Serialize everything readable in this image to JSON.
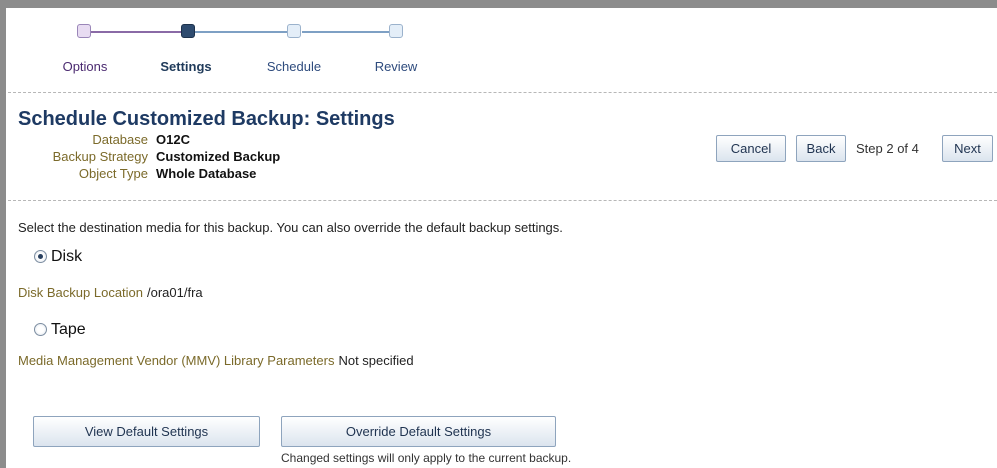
{
  "train": {
    "steps": [
      {
        "label": "Options",
        "state": "visited"
      },
      {
        "label": "Settings",
        "state": "current"
      },
      {
        "label": "Schedule",
        "state": "future"
      },
      {
        "label": "Review",
        "state": "future"
      }
    ]
  },
  "page": {
    "title": "Schedule Customized Backup: Settings",
    "info": [
      {
        "label": "Database",
        "value": "O12C"
      },
      {
        "label": "Backup Strategy",
        "value": "Customized Backup"
      },
      {
        "label": "Object Type",
        "value": "Whole Database"
      }
    ]
  },
  "nav": {
    "cancel": "Cancel",
    "back": "Back",
    "step_text": "Step 2 of 4",
    "next": "Next"
  },
  "content": {
    "instruction": "Select the destination media for this backup. You can also override the default backup settings.",
    "disk": {
      "label": "Disk",
      "selected": true,
      "location_label": "Disk Backup Location",
      "location_value": "/ora01/fra"
    },
    "tape": {
      "label": "Tape",
      "selected": false,
      "mmv_label": "Media Management Vendor (MMV) Library Parameters",
      "mmv_value": "Not specified"
    },
    "view_default": "View Default Settings",
    "override_default": "Override Default Settings",
    "override_note": "Changed settings will only apply to the current backup."
  },
  "colors": {
    "title": "#1e3a63",
    "label": "#7b6a2a",
    "current_step": "#2e4b6f"
  }
}
